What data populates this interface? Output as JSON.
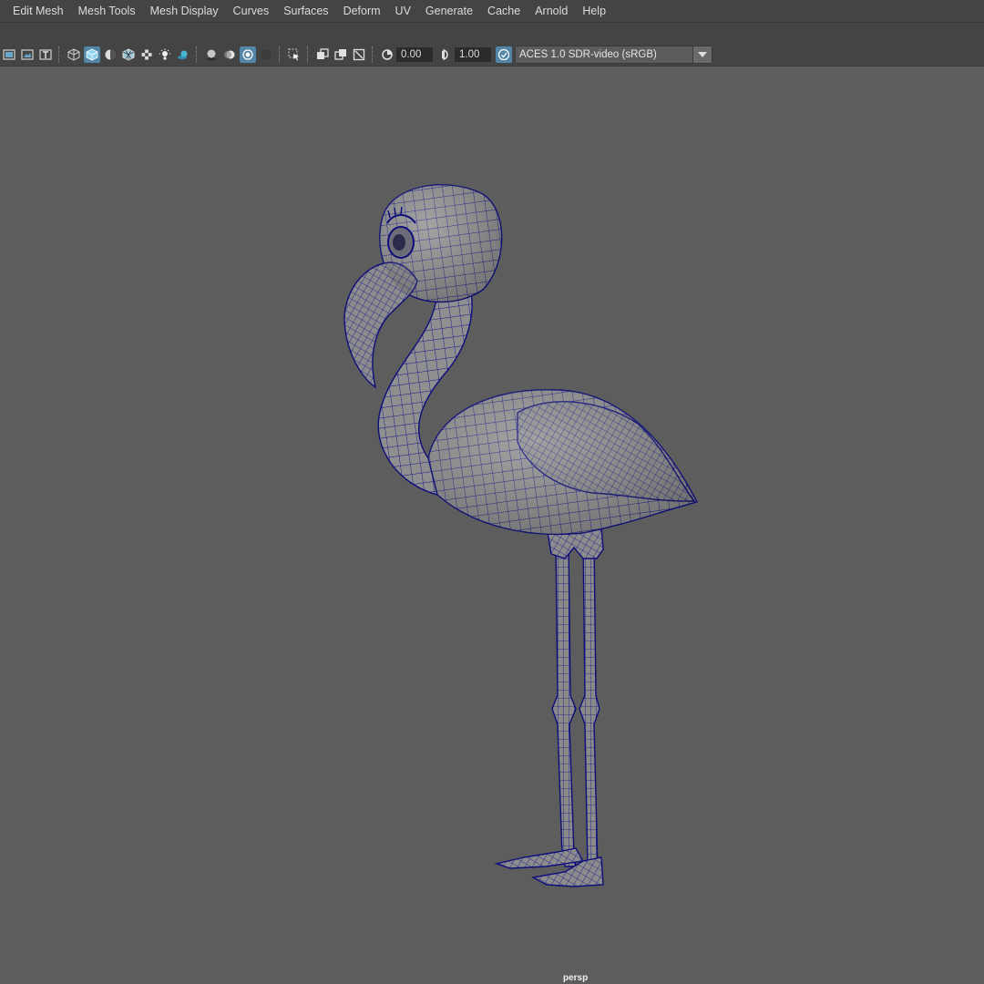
{
  "menu": [
    "Edit Mesh",
    "Mesh Tools",
    "Mesh Display",
    "Curves",
    "Surfaces",
    "Deform",
    "UV",
    "Generate",
    "Cache",
    "Arnold",
    "Help"
  ],
  "toolbar": {
    "exposure_value": "0.00",
    "gamma_value": "1.00",
    "color_space": "ACES 1.0 SDR-video (sRGB)"
  },
  "viewport": {
    "camera": "persp",
    "model_name": "flamingo",
    "wire_color": "#0e0e7a",
    "surface_color": "#8f8f8f",
    "background_color": "#5d5d5d"
  },
  "colors": {
    "accent": "#5285a6",
    "menu_bg": "#444444",
    "text": "#dcdcdc"
  }
}
